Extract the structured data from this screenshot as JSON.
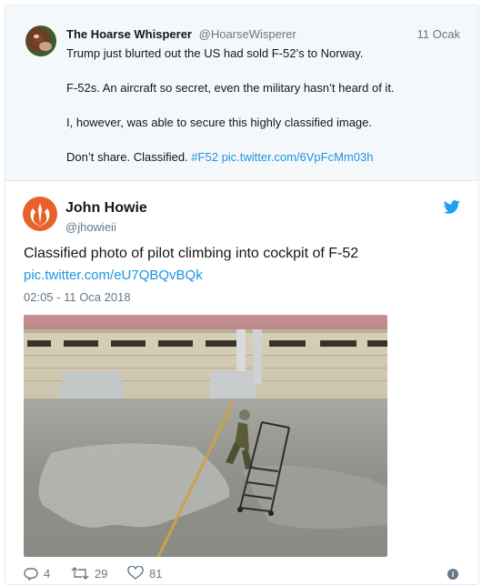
{
  "quoted_tweet": {
    "author_name": "The Hoarse Whisperer",
    "author_handle": "@HoarseWisperer",
    "date": "11 Ocak",
    "lines": [
      "Trump just blurted out the US had sold F-52’s to Norway.",
      "F-52s. An aircraft so secret, even the military hasn’t heard of it.",
      "I, however, was able to secure this highly classified image.",
      "Don’t share. Classified."
    ],
    "hashtag": "#F52",
    "link": "pic.twitter.com/6VpFcMm03h"
  },
  "tweet": {
    "author_name": "John Howie",
    "author_handle": "@jhowieii",
    "text": "Classified photo of pilot climbing into cockpit of F-52",
    "link": "pic.twitter.com/eU7QBQvBQk",
    "timestamp": "02:05 - 11 Oca 2018",
    "reply_count": "4",
    "retweet_count": "29",
    "like_count": "81"
  },
  "icons": [
    "twitter-bird-icon",
    "rebel-alliance-avatar-icon",
    "reply-icon",
    "retweet-icon",
    "heart-icon",
    "info-icon"
  ],
  "colors": {
    "link": "#1b95e0",
    "secondary": "#657786",
    "avatar_orange": "#e8612b",
    "quoted_bg": "#f5f8fa"
  }
}
